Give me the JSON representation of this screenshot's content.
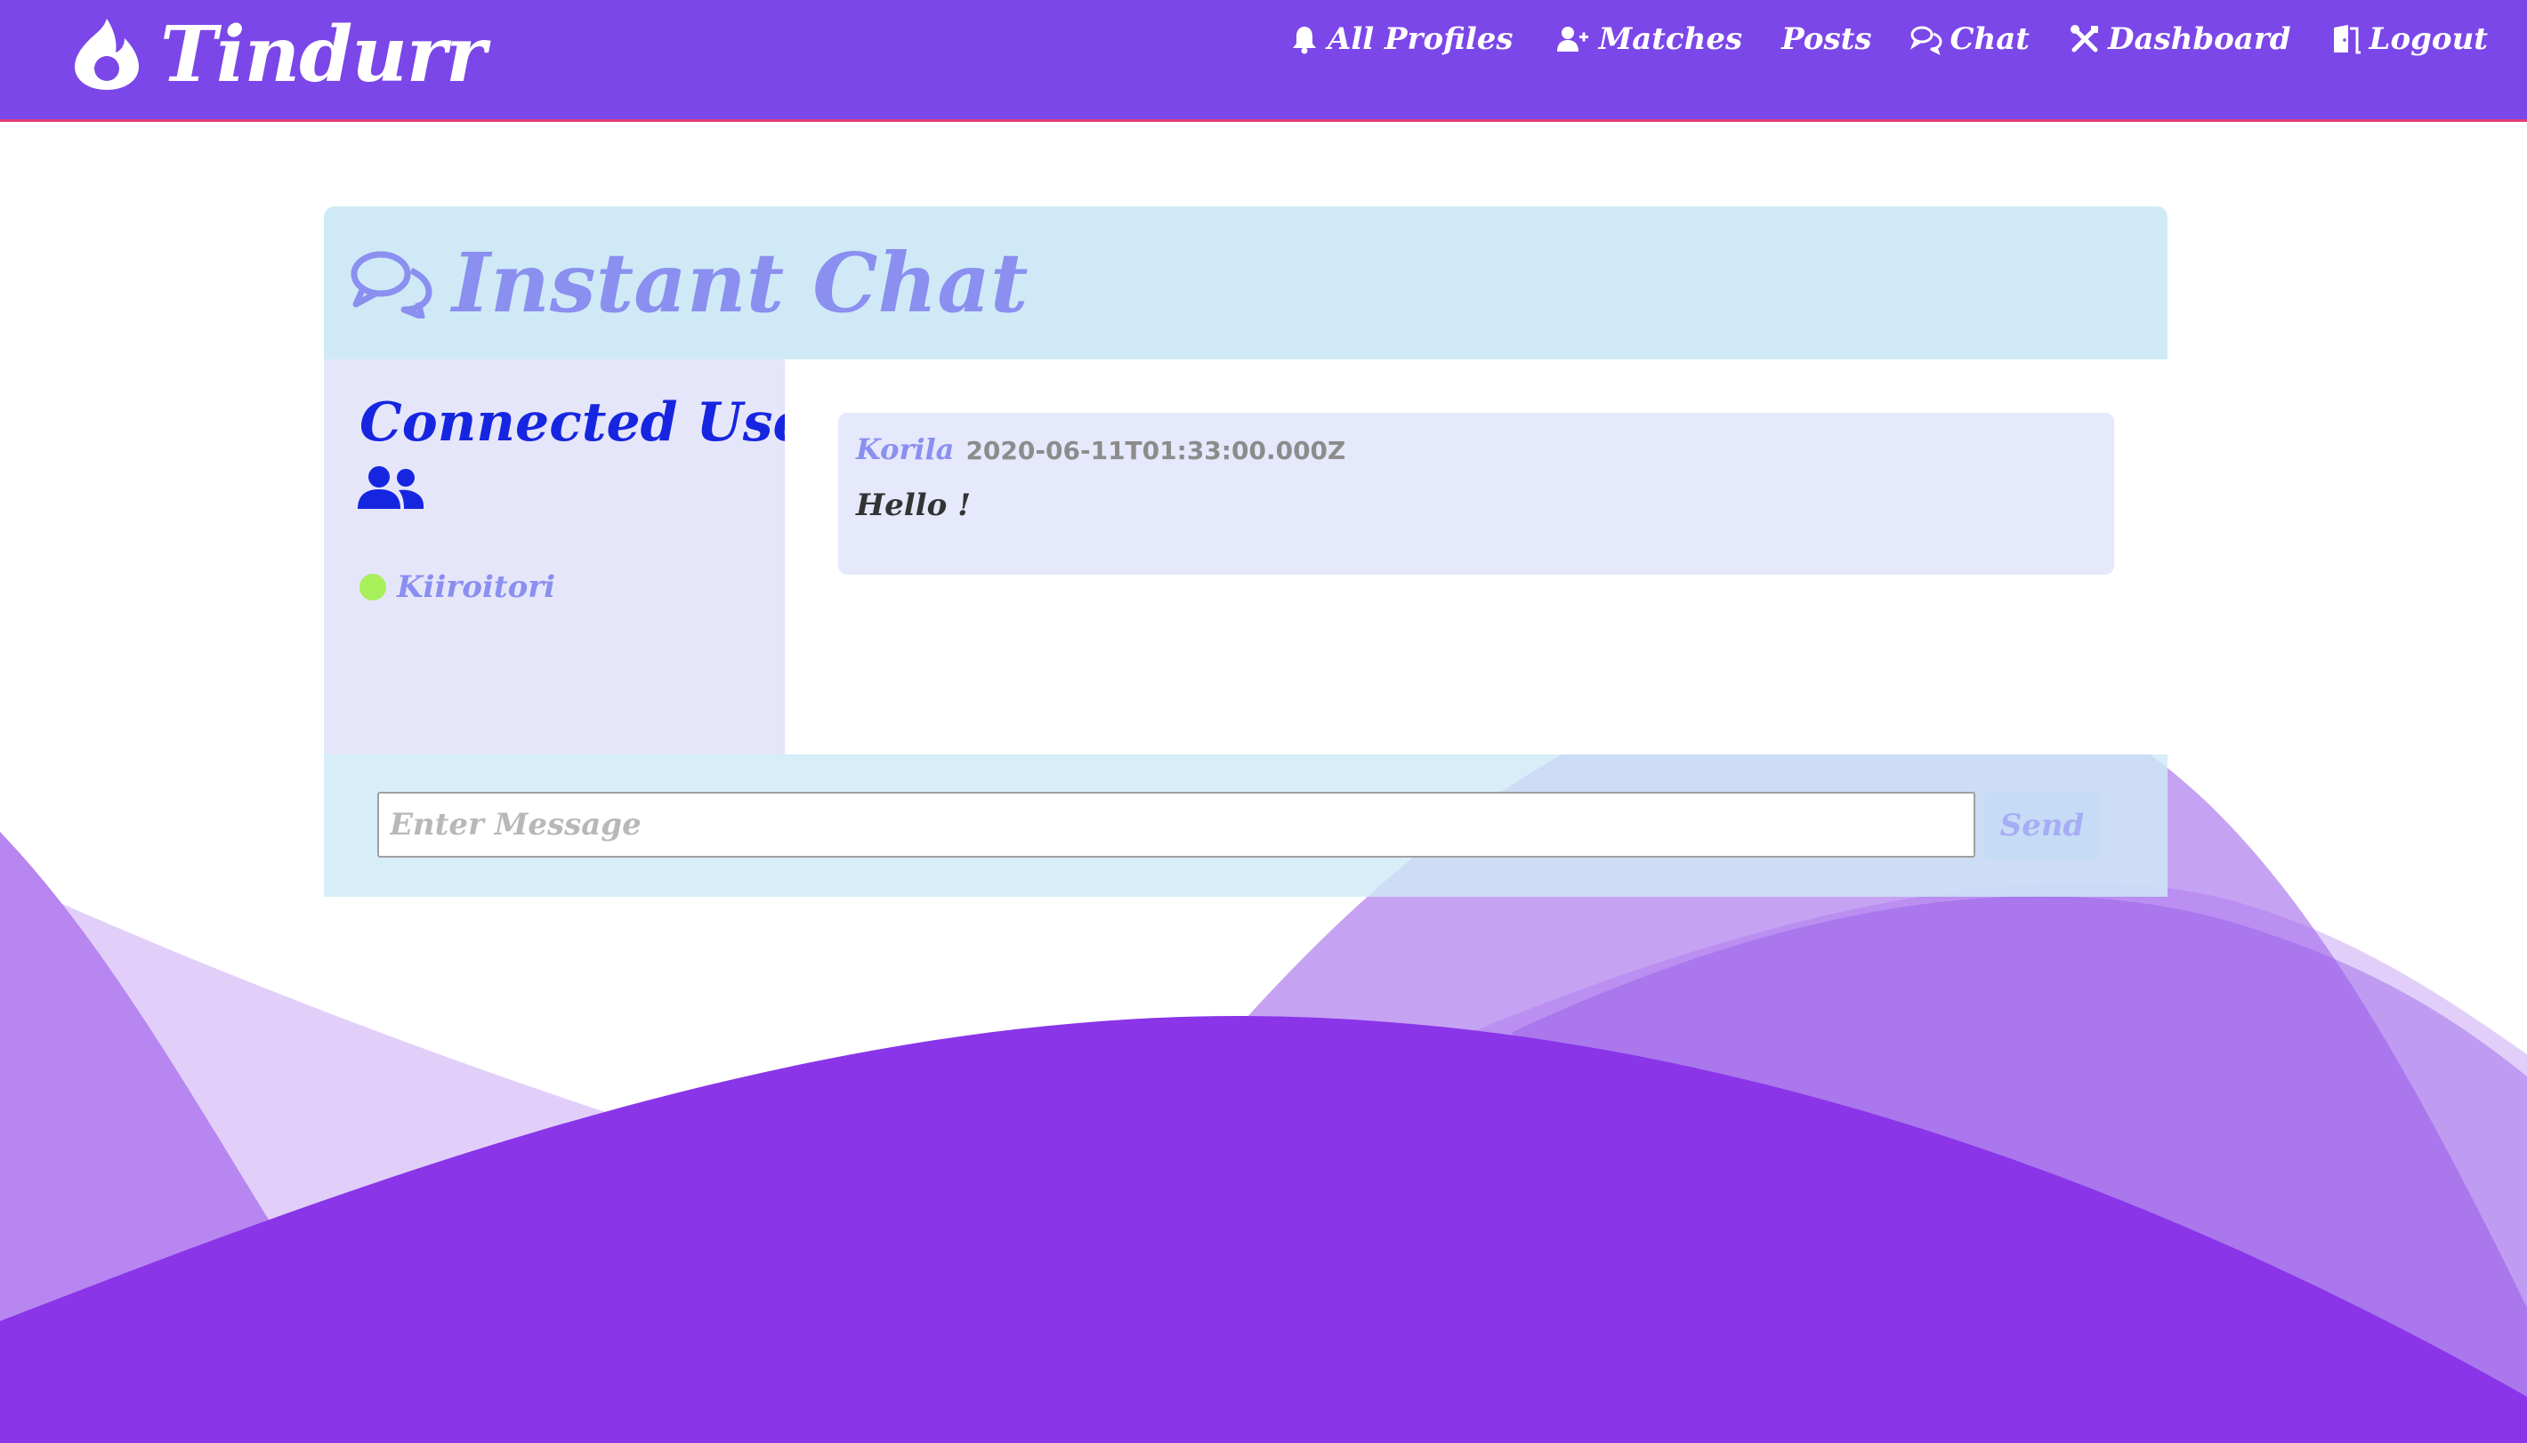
{
  "navbar": {
    "brand": "Tindurr",
    "items": [
      {
        "label": "All Profiles",
        "icon": "bell-icon"
      },
      {
        "label": "Matches",
        "icon": "user-plus-icon"
      },
      {
        "label": "Posts",
        "icon": ""
      },
      {
        "label": "Chat",
        "icon": "chat-icon"
      },
      {
        "label": "Dashboard",
        "icon": "tools-icon"
      },
      {
        "label": "Logout",
        "icon": "door-icon"
      }
    ]
  },
  "chat": {
    "title": "Instant Chat",
    "users_panel": {
      "title": "Connected Users",
      "users": [
        {
          "name": "Kiiroitori",
          "status": "online"
        }
      ]
    },
    "messages": [
      {
        "author": "Korila",
        "timestamp": "2020-06-11T01:33:00.000Z",
        "text": "Hello !"
      }
    ],
    "input": {
      "placeholder": "Enter Message",
      "value": ""
    },
    "send_label": "Send"
  },
  "colors": {
    "navbar": "#7b47e8",
    "header_bg": "#cfeaf6",
    "panel_bg": "#e6e6fa",
    "title_text": "#8a8ff0",
    "users_title": "#1626e0",
    "online": "#a8f05a",
    "wave_dark": "#8a35e8"
  }
}
